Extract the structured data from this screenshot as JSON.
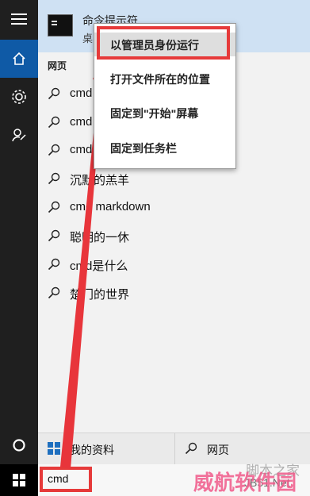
{
  "best_match": {
    "title": "命令提示符",
    "subtitle": "桌"
  },
  "section_label": "网页",
  "results": [
    "cmd",
    "cmd",
    "cmd",
    "沉默的羔羊",
    "cmd markdown",
    "聪明的一休",
    "cmd是什么",
    "楚门的世界"
  ],
  "context_menu": [
    "以管理员身份运行",
    "打开文件所在的位置",
    "固定到\"开始\"屏幕",
    "固定到任务栏"
  ],
  "bottom_tabs": {
    "my_stuff": "我的资料",
    "web": "网页"
  },
  "search": {
    "query": "cmd"
  },
  "watermark": {
    "line1": "脚本之家",
    "line2": "JB51.Net",
    "line3": "威航软件园"
  },
  "colors": {
    "accent": "#0f5aa6",
    "highlight_box": "#e63a3a",
    "rail": "#1f1f1f"
  }
}
